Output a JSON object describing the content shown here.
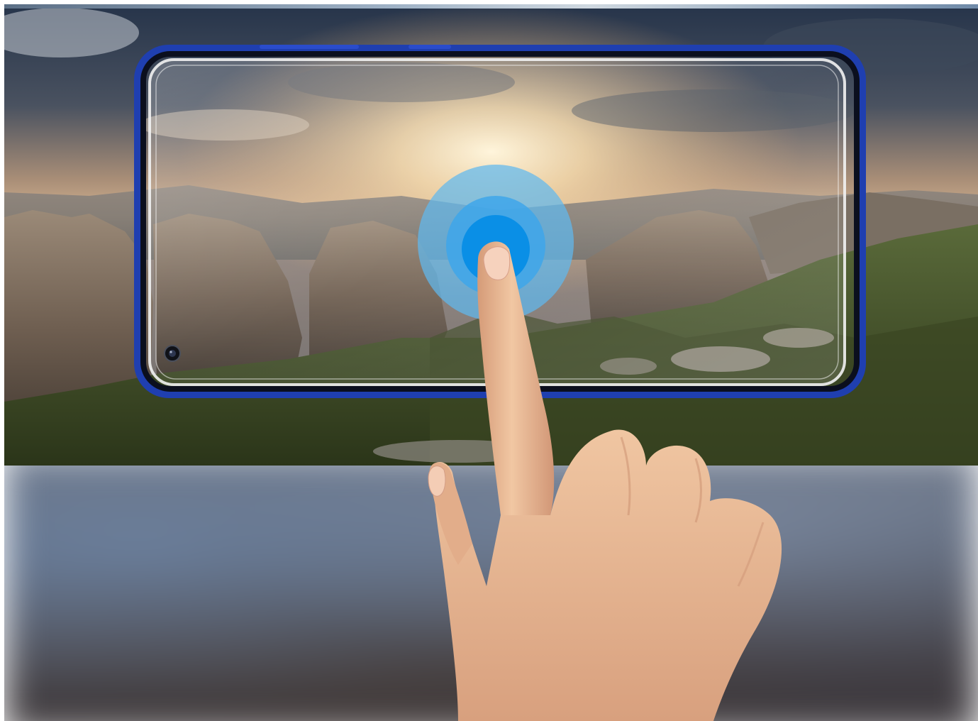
{
  "scene": {
    "subject": "hand-touching-phone-screen-protector",
    "colors": {
      "sky_top": "#2c3a4d",
      "sunset_glow": "#f3d3a0",
      "rock": "#6b5a4a",
      "forest": "#3f4d25",
      "phone_frame": "#1f3fb0",
      "touch_ripple_outer": "#5fb8ee",
      "touch_ripple_inner": "#0a8fe6",
      "skin": "#e8b892"
    },
    "icons": {
      "front_camera": "camera-lens-icon",
      "touch_point": "touch-ripple-icon"
    }
  }
}
